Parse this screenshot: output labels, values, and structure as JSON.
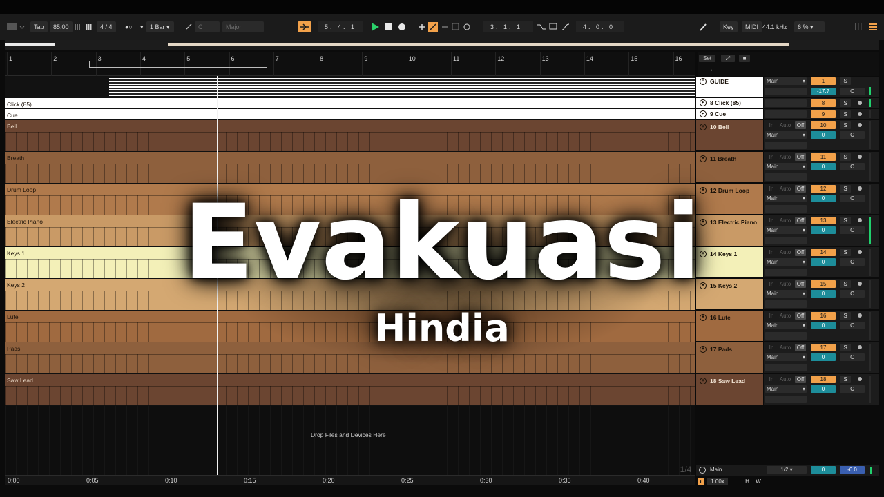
{
  "transport": {
    "tap": "Tap",
    "tempo": "85.00",
    "time_signature": "4 / 4",
    "metronome": "●○",
    "quantize": "1 Bar",
    "key_root": "C",
    "scale": "Major",
    "position": "5.   4.   1",
    "loop_start": "3.   1.   1",
    "loop_length": "4.   0.   0",
    "key_label": "Key",
    "midi_label": "MIDI",
    "sample_rate": "44.1 kHz",
    "cpu": "6 %"
  },
  "ruler": {
    "bars": [
      "1",
      "2",
      "3",
      "4",
      "5",
      "6",
      "7",
      "8",
      "9",
      "10",
      "11",
      "12",
      "13",
      "14",
      "15",
      "16"
    ],
    "set_label": "Set"
  },
  "tracks": [
    {
      "name": "GUIDE",
      "header": "GUIDE",
      "output": "Main",
      "number": "1",
      "volume": "-17.7",
      "pan": "C",
      "color": "#ffffff"
    },
    {
      "name": "Click (85)",
      "header": "8 Click (85)",
      "output": "",
      "number": "8",
      "volume": "",
      "pan": "",
      "color": "#ffffff"
    },
    {
      "name": "Cue",
      "header": "9 Cue",
      "output": "",
      "number": "9",
      "volume": "",
      "pan": "",
      "color": "#ffffff"
    },
    {
      "name": "Bell",
      "header": "10 Bell",
      "output": "Main",
      "number": "10",
      "volume": "0",
      "pan": "C",
      "color": "#6b4531"
    },
    {
      "name": "Breath",
      "header": "11 Breath",
      "output": "Main",
      "number": "11",
      "volume": "0",
      "pan": "C",
      "color": "#8e603d"
    },
    {
      "name": "Drum Loop",
      "header": "12 Drum Loop",
      "output": "Main",
      "number": "12",
      "volume": "0",
      "pan": "C",
      "color": "#b07a4c"
    },
    {
      "name": "Electric Piano",
      "header": "13 Electric Piano",
      "output": "Main",
      "number": "13",
      "volume": "0",
      "pan": "C",
      "color": "#c99a66"
    },
    {
      "name": "Keys 1",
      "header": "14 Keys 1",
      "output": "Main",
      "number": "14",
      "volume": "0",
      "pan": "C",
      "color": "#f3f0b8"
    },
    {
      "name": "Keys 2",
      "header": "15 Keys 2",
      "output": "Main",
      "number": "15",
      "volume": "0",
      "pan": "C",
      "color": "#d4a872"
    },
    {
      "name": "Lute",
      "header": "16 Lute",
      "output": "Main",
      "number": "16",
      "volume": "0",
      "pan": "C",
      "color": "#a06a40"
    },
    {
      "name": "Pads",
      "header": "17 Pads",
      "output": "Main",
      "number": "17",
      "volume": "0",
      "pan": "C",
      "color": "#8e603d"
    },
    {
      "name": "Saw Lead",
      "header": "18 Saw Lead",
      "output": "Main",
      "number": "18",
      "volume": "0",
      "pan": "C",
      "color": "#6b4531"
    }
  ],
  "mixer_labels": {
    "in": "In",
    "auto": "Auto",
    "off": "Off",
    "solo": "S"
  },
  "drop_text": "Drop Files and Devices Here",
  "main_track": {
    "label": "Main",
    "page": "1/4",
    "routing": "1/2",
    "volume": "0",
    "pan": "-6.0"
  },
  "timeline": [
    "0:00",
    "0:05",
    "0:10",
    "0:15",
    "0:20",
    "0:25",
    "0:30",
    "0:35",
    "0:40"
  ],
  "status": {
    "zoom": "1.00x",
    "h": "H",
    "w": "W"
  },
  "overlay": {
    "title": "Evakuasi",
    "subtitle": "Hindia"
  }
}
